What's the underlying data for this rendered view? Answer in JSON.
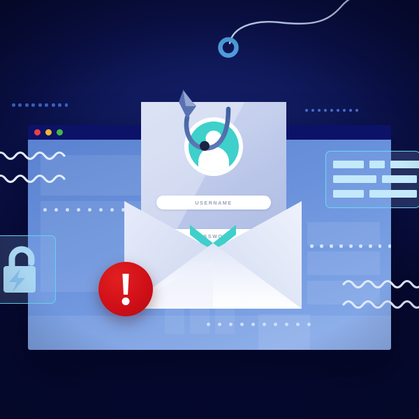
{
  "illustration": {
    "title": "Phishing attack illustration",
    "theme": "credential phishing",
    "background_color": "#0a1046",
    "accent_color": "#3fd0cb",
    "alert_color": "#cf0f17",
    "hook_color": "#4f9fe0"
  },
  "browser_window": {
    "name": "browser-window",
    "traffic_lights": [
      {
        "name": "close",
        "color": "#e84141"
      },
      {
        "name": "minimize",
        "color": "#f0b72c"
      },
      {
        "name": "maximize",
        "color": "#3fbb43"
      }
    ],
    "titlebar_color": "#0c1268",
    "viewport_color": "#6a92dc"
  },
  "login_form": {
    "name": "phishing-login-form",
    "avatar_label": "user-avatar",
    "fields": [
      {
        "name": "username",
        "placeholder": "USERNAME",
        "value": ""
      },
      {
        "name": "password",
        "placeholder": "PASSWORD",
        "value": ""
      }
    ]
  },
  "envelope": {
    "name": "open-envelope",
    "flap_accent_color": "#3fd0cb"
  },
  "alert_badge": {
    "name": "warning-alert",
    "symbol": "!",
    "color": "#cf0f17"
  },
  "lock_badge": {
    "name": "broken-lock",
    "state": "unlocked",
    "border_color": "#5fd5f2"
  },
  "info_card": {
    "name": "data-record-card",
    "border_color": "#69d8f5",
    "rows": [
      [
        44,
        22,
        46
      ],
      [
        62,
        50
      ],
      [
        44,
        68
      ]
    ]
  },
  "hook": {
    "name": "fishing-hook",
    "line_color": "#c9dcf5",
    "ring_color": "#4f9fe0"
  },
  "decorations": {
    "dot_rows": [
      {
        "name": "dots-top-left",
        "count": 9,
        "color": "#3d63c9"
      },
      {
        "name": "dots-top-right",
        "count": 9,
        "color": "#4a6fd4"
      },
      {
        "name": "dots-window-mid",
        "count": 10,
        "color": "#cfe0f8"
      },
      {
        "name": "dots-window-right",
        "count": 9,
        "color": "#d6e6fb"
      },
      {
        "name": "dots-window-low",
        "count": 10,
        "color": "#cddff8"
      }
    ],
    "waves": [
      {
        "name": "wave-left-upper",
        "color": "#e2edfb"
      },
      {
        "name": "wave-left-lower",
        "color": "#e2edfb"
      },
      {
        "name": "wave-right-upper",
        "color": "#dfeafb"
      },
      {
        "name": "wave-right-lower",
        "color": "#dfeafb"
      }
    ]
  }
}
